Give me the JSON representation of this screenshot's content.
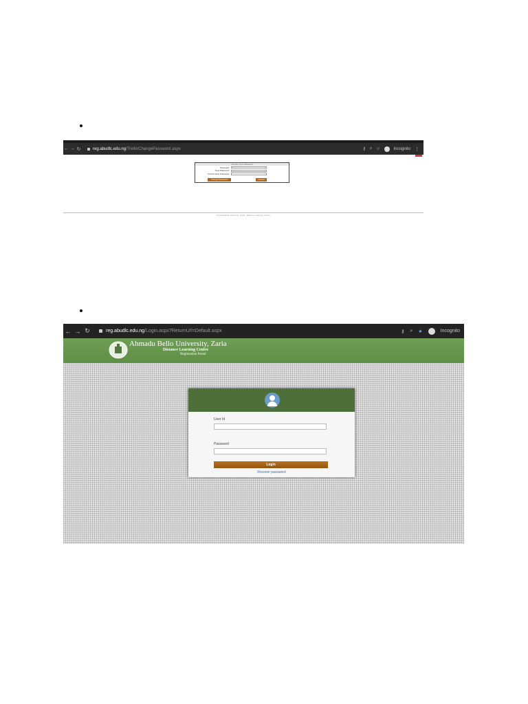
{
  "screenshot1": {
    "url_host": "reg.abudlc.edu.ng",
    "url_path": "/Trello/ChangePassword.aspx",
    "toolbar": {
      "incognito_label": "Incognito"
    },
    "form": {
      "title": "Change Your Password",
      "fields": [
        {
          "label": "Password:"
        },
        {
          "label": "New Password:"
        },
        {
          "label": "Confirm New Password:"
        }
      ],
      "change_button": "Change Password",
      "cancel_button": "Cancel"
    },
    "footer": "Ahmadu Bello University, Zaria · Distance Learning Centre"
  },
  "screenshot2": {
    "url_host": "reg.abudlc.edu.ng",
    "url_path": "/Login.aspx?ReturnUrl=Default.aspx",
    "toolbar": {
      "incognito_label": "Incognito"
    },
    "header": {
      "university": "Ahmadu Bello University, Zaria",
      "centre": "Distance Learning Centre",
      "portal": "Registration Portal"
    },
    "login": {
      "userid_label": "User Id",
      "password_label": "Password",
      "login_button": "Login",
      "recover_link": "Recover password"
    }
  },
  "colors": {
    "header_green": "#6f9e55",
    "card_header_green": "#4f6f3a",
    "button_orange": "#b5651d",
    "avatar_blue": "#6b9bc8",
    "link_blue": "#3a6fb0"
  },
  "icons": [
    "back-arrow-icon",
    "forward-arrow-icon",
    "reload-icon",
    "lock-icon",
    "key-icon",
    "zoom-icon",
    "star-icon",
    "incognito-icon",
    "menu-dots-icon",
    "user-avatar-icon",
    "university-logo"
  ]
}
